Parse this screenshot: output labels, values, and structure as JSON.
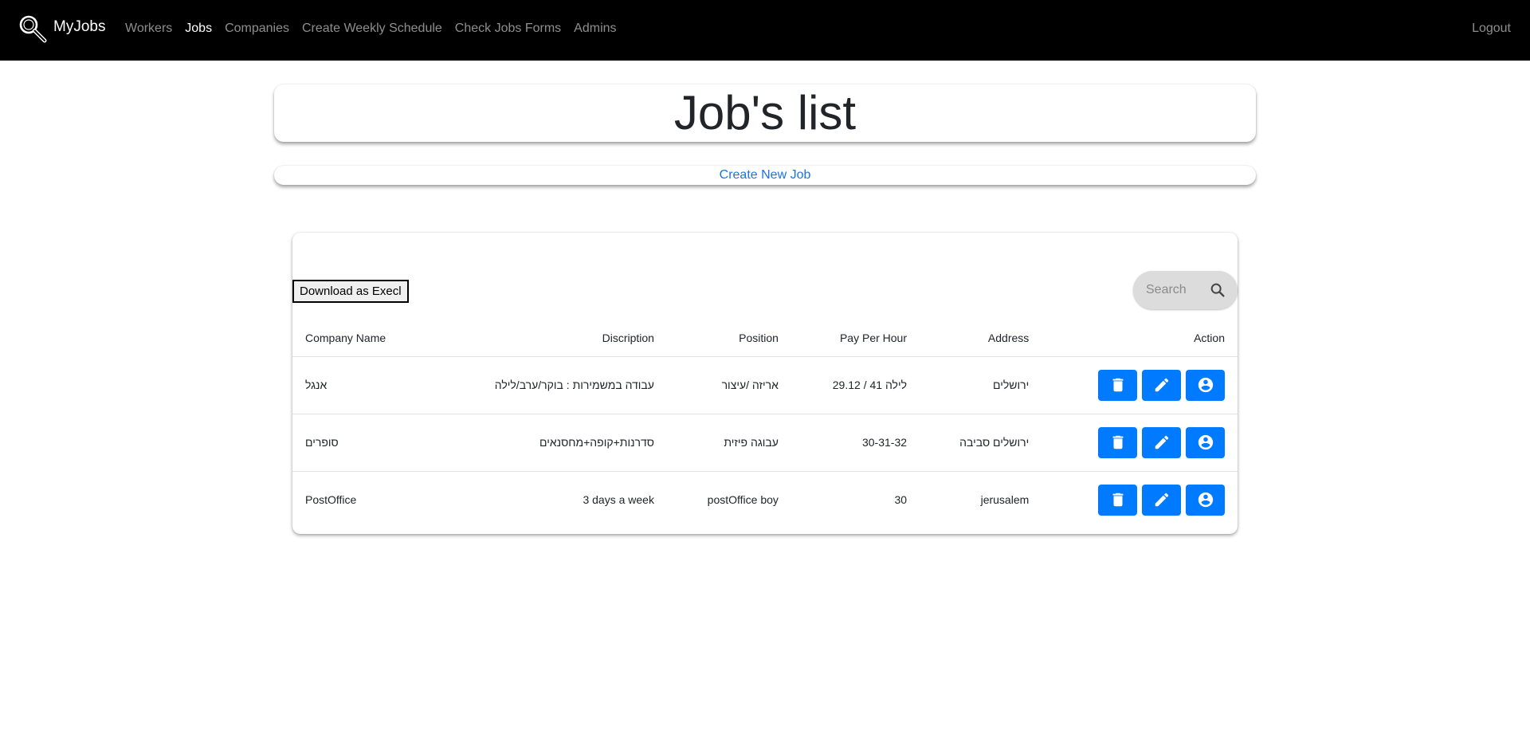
{
  "navbar": {
    "brand": "MyJobs",
    "links": [
      {
        "label": "Workers",
        "active": false
      },
      {
        "label": "Jobs",
        "active": true
      },
      {
        "label": "Companies",
        "active": false
      },
      {
        "label": "Create Weekly Schedule",
        "active": false
      },
      {
        "label": "Check Jobs Forms",
        "active": false
      },
      {
        "label": "Admins",
        "active": false
      }
    ],
    "logout": "Logout"
  },
  "page": {
    "title": "Job's list",
    "create_link": "Create New Job"
  },
  "table": {
    "download_label": "Download as Execl",
    "search_placeholder": "Search",
    "columns": [
      "Company Name",
      "Discription",
      "Position",
      "Pay Per Hour",
      "Address",
      "Action"
    ],
    "rows": [
      {
        "company": "אנגל",
        "description": "עבודה במשמירות : בוקר/ערב/לילה",
        "position": "אריזה /עיצור",
        "pay": "29.12 / 41 לילה",
        "address": "ירושלים"
      },
      {
        "company": "סופרים",
        "description": "סדרנות+קופה+מחסנאים",
        "position": "עבוגה פיזית",
        "pay": "30-31-32",
        "address": "ירושלים סביבה"
      },
      {
        "company": "PostOffice",
        "description": "3 days a week",
        "position": "postOffice boy",
        "pay": "30",
        "address": "jerusalem"
      }
    ],
    "actions": [
      {
        "name": "delete-button",
        "icon": "trash-icon"
      },
      {
        "name": "edit-button",
        "icon": "pencil-icon"
      },
      {
        "name": "assign-button",
        "icon": "user-circle-icon"
      }
    ]
  },
  "colors": {
    "navbar_bg": "#000000",
    "primary": "#007bff",
    "link": "#1a73e8"
  }
}
